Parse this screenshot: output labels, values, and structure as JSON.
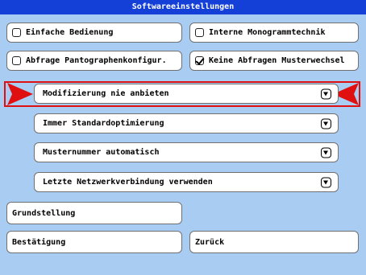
{
  "title": "Softwareeinstellungen",
  "checkboxes": [
    {
      "label": "Einfache Bedienung",
      "checked": false
    },
    {
      "label": "Interne Monogrammtechnik",
      "checked": false
    },
    {
      "label": "Abfrage Pantographenkonfigur.",
      "checked": false
    },
    {
      "label": "Keine Abfragen Musterwechsel",
      "checked": true
    }
  ],
  "dropdowns": [
    {
      "value": "Modifizierung nie anbieten",
      "selected": true
    },
    {
      "value": "Immer Standardoptimierung"
    },
    {
      "value": "Musternummer automatisch"
    },
    {
      "value": "Letzte Netzwerkverbindung verwenden"
    }
  ],
  "buttons": {
    "reset": "Grundstellung",
    "confirm": "Bestätigung",
    "back": "Zurück"
  },
  "colors": {
    "background": "#a9cdf2",
    "titlebar": "#1540d8",
    "highlight": "#e01010"
  }
}
